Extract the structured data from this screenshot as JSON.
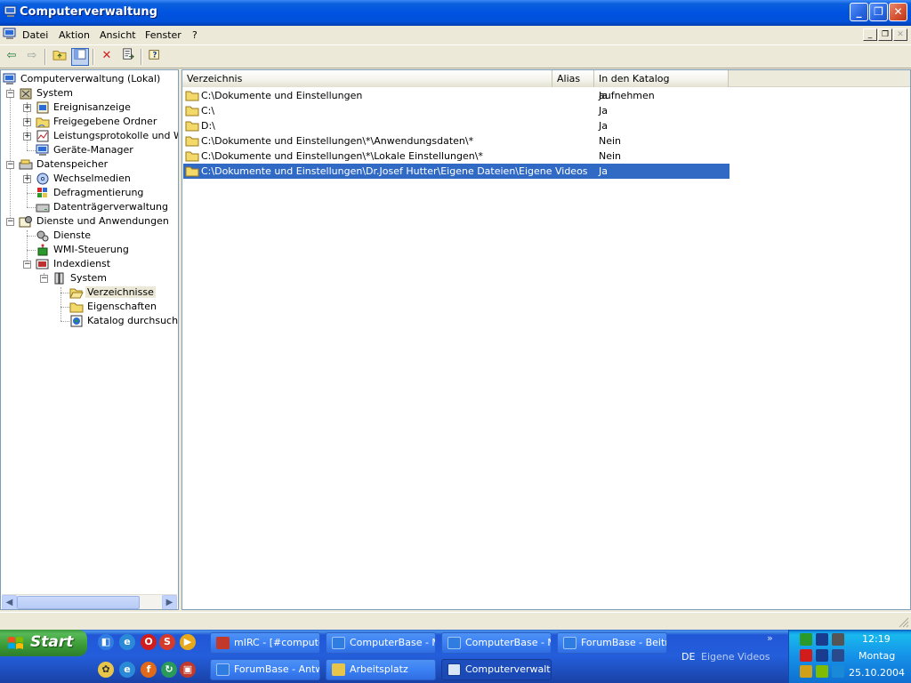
{
  "window": {
    "title": "Computerverwaltung"
  },
  "menu": {
    "items": [
      "Datei",
      "Aktion",
      "Ansicht",
      "Fenster",
      "?"
    ]
  },
  "toolbar": {
    "buttons": [
      "back-icon",
      "forward-icon",
      "up-folder-icon",
      "show-hide-tree-icon",
      "delete-icon",
      "export-list-icon",
      "help-icon"
    ]
  },
  "tree": {
    "root": "Computerverwaltung (Lokal)",
    "system": "System",
    "ereignisanzeige": "Ereignisanzeige",
    "freigegebene": "Freigegebene Ordner",
    "leistung": "Leistungsprotokolle und Warnungen",
    "geraete": "Geräte-Manager",
    "datenspeicher": "Datenspeicher",
    "wechselmedien": "Wechselmedien",
    "defrag": "Defragmentierung",
    "datentraeger": "Datenträgerverwaltung",
    "dienste_anw": "Dienste und Anwendungen",
    "dienste": "Dienste",
    "wmi": "WMI-Steuerung",
    "indexdienst": "Indexdienst",
    "idx_system": "System",
    "verzeichnisse": "Verzeichnisse",
    "eigenschaften": "Eigenschaften",
    "katalog": "Katalog durchsuchen"
  },
  "list": {
    "columns": [
      "Verzeichnis",
      "Alias",
      "In den Katalog aufnehmen"
    ],
    "rows": [
      {
        "path": "C:\\Dokumente und Einstellungen",
        "alias": "",
        "include": "Ja"
      },
      {
        "path": "C:\\",
        "alias": "",
        "include": "Ja"
      },
      {
        "path": "D:\\",
        "alias": "",
        "include": "Ja"
      },
      {
        "path": "C:\\Dokumente und Einstellungen\\*\\Anwendungsdaten\\*",
        "alias": "",
        "include": "Nein"
      },
      {
        "path": "C:\\Dokumente und Einstellungen\\*\\Lokale Einstellungen\\*",
        "alias": "",
        "include": "Nein"
      },
      {
        "path": "C:\\Dokumente und Einstellungen\\Dr.Josef Hutter\\Eigene Dateien\\Eigene Videos",
        "alias": "",
        "include": "Ja"
      }
    ],
    "selected_index": 5
  },
  "taskbar": {
    "start_label": "Start",
    "tasks": [
      {
        "label": "mIRC - [#computerbase]",
        "color": "#c0392b"
      },
      {
        "label": "ComputerBase - Microsoft Internet Explorer",
        "color": "#2f7de0"
      },
      {
        "label": "ComputerBase - Microsoft Internet Explorer",
        "color": "#2f7de0"
      },
      {
        "label": "ForumBase - Beiträge",
        "color": "#2f7de0"
      },
      {
        "label": "ForumBase - Antworten",
        "color": "#2f7de0"
      },
      {
        "label": "Arbeitsplatz",
        "color": "#e7c54a"
      },
      {
        "label": "Computerverwaltung",
        "color": "#5b7fc6"
      }
    ],
    "lang": "DE",
    "deskbar": "Eigene Videos",
    "clock": {
      "time": "12:19",
      "day": "Montag",
      "date": "25.10.2004"
    }
  },
  "colors": {
    "selection": "#316ac5",
    "titlebar": "#0053e1",
    "start": "#3a9a35"
  }
}
